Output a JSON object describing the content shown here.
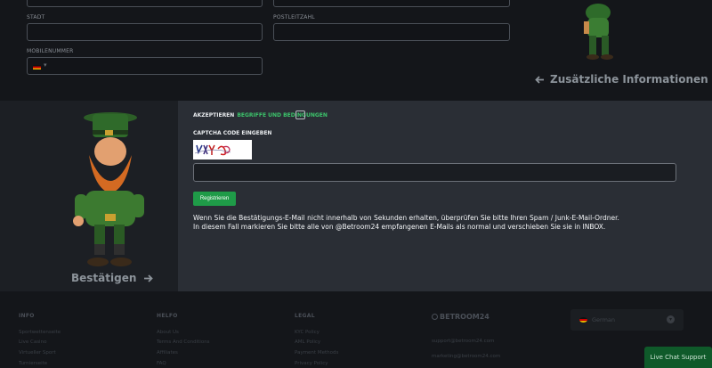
{
  "form": {
    "city_label": "STADT",
    "postal_label": "POSTLEITZAHL",
    "mobile_label": "MOBILENUMMER",
    "mobile_caret": "▾"
  },
  "nav": {
    "more_info": "Zusätzliche Informationen",
    "confirm": "Bestätigen"
  },
  "terms": {
    "accept": "AKZEPTIEREN",
    "link": "BEGRIFFE UND BEDINGUNGEN"
  },
  "captcha": {
    "label": "CAPTCHA CODE EINGEBEN",
    "input_value": ""
  },
  "register_label": "Registrieren",
  "notice": {
    "line1": "Wenn Sie die Bestätigungs-E-Mail nicht innerhalb von Sekunden erhalten, überprüfen Sie bitte Ihren Spam / Junk-E-Mail-Ordner.",
    "line2": "In diesem Fall markieren Sie bitte alle von @Betroom24 empfangenen E-Mails als normal und verschieben Sie sie in INBOX."
  },
  "footer": {
    "col1": {
      "head": "INFO",
      "links": [
        "Sportwettenseite",
        "Live Casino",
        "Virtueller Sport",
        "Turnierseite"
      ]
    },
    "col2": {
      "head": "HELFO",
      "links": [
        "About Us",
        "Terms And Conditions",
        "Affiliates",
        "FAQ"
      ]
    },
    "col3": {
      "head": "LEGAL",
      "links": [
        "KYC Policy",
        "AML Policy",
        "Payment Methods",
        "Privacy Policy"
      ]
    },
    "brand": "BETROOM24",
    "emails": [
      "support@betroom24.com",
      "marketing@betroom24.com"
    ],
    "language": "German",
    "chat": "Live Chat Support"
  },
  "colors": {
    "accent": "#1f9b48",
    "link": "#3cc46b",
    "panel": "#2a2e35"
  }
}
